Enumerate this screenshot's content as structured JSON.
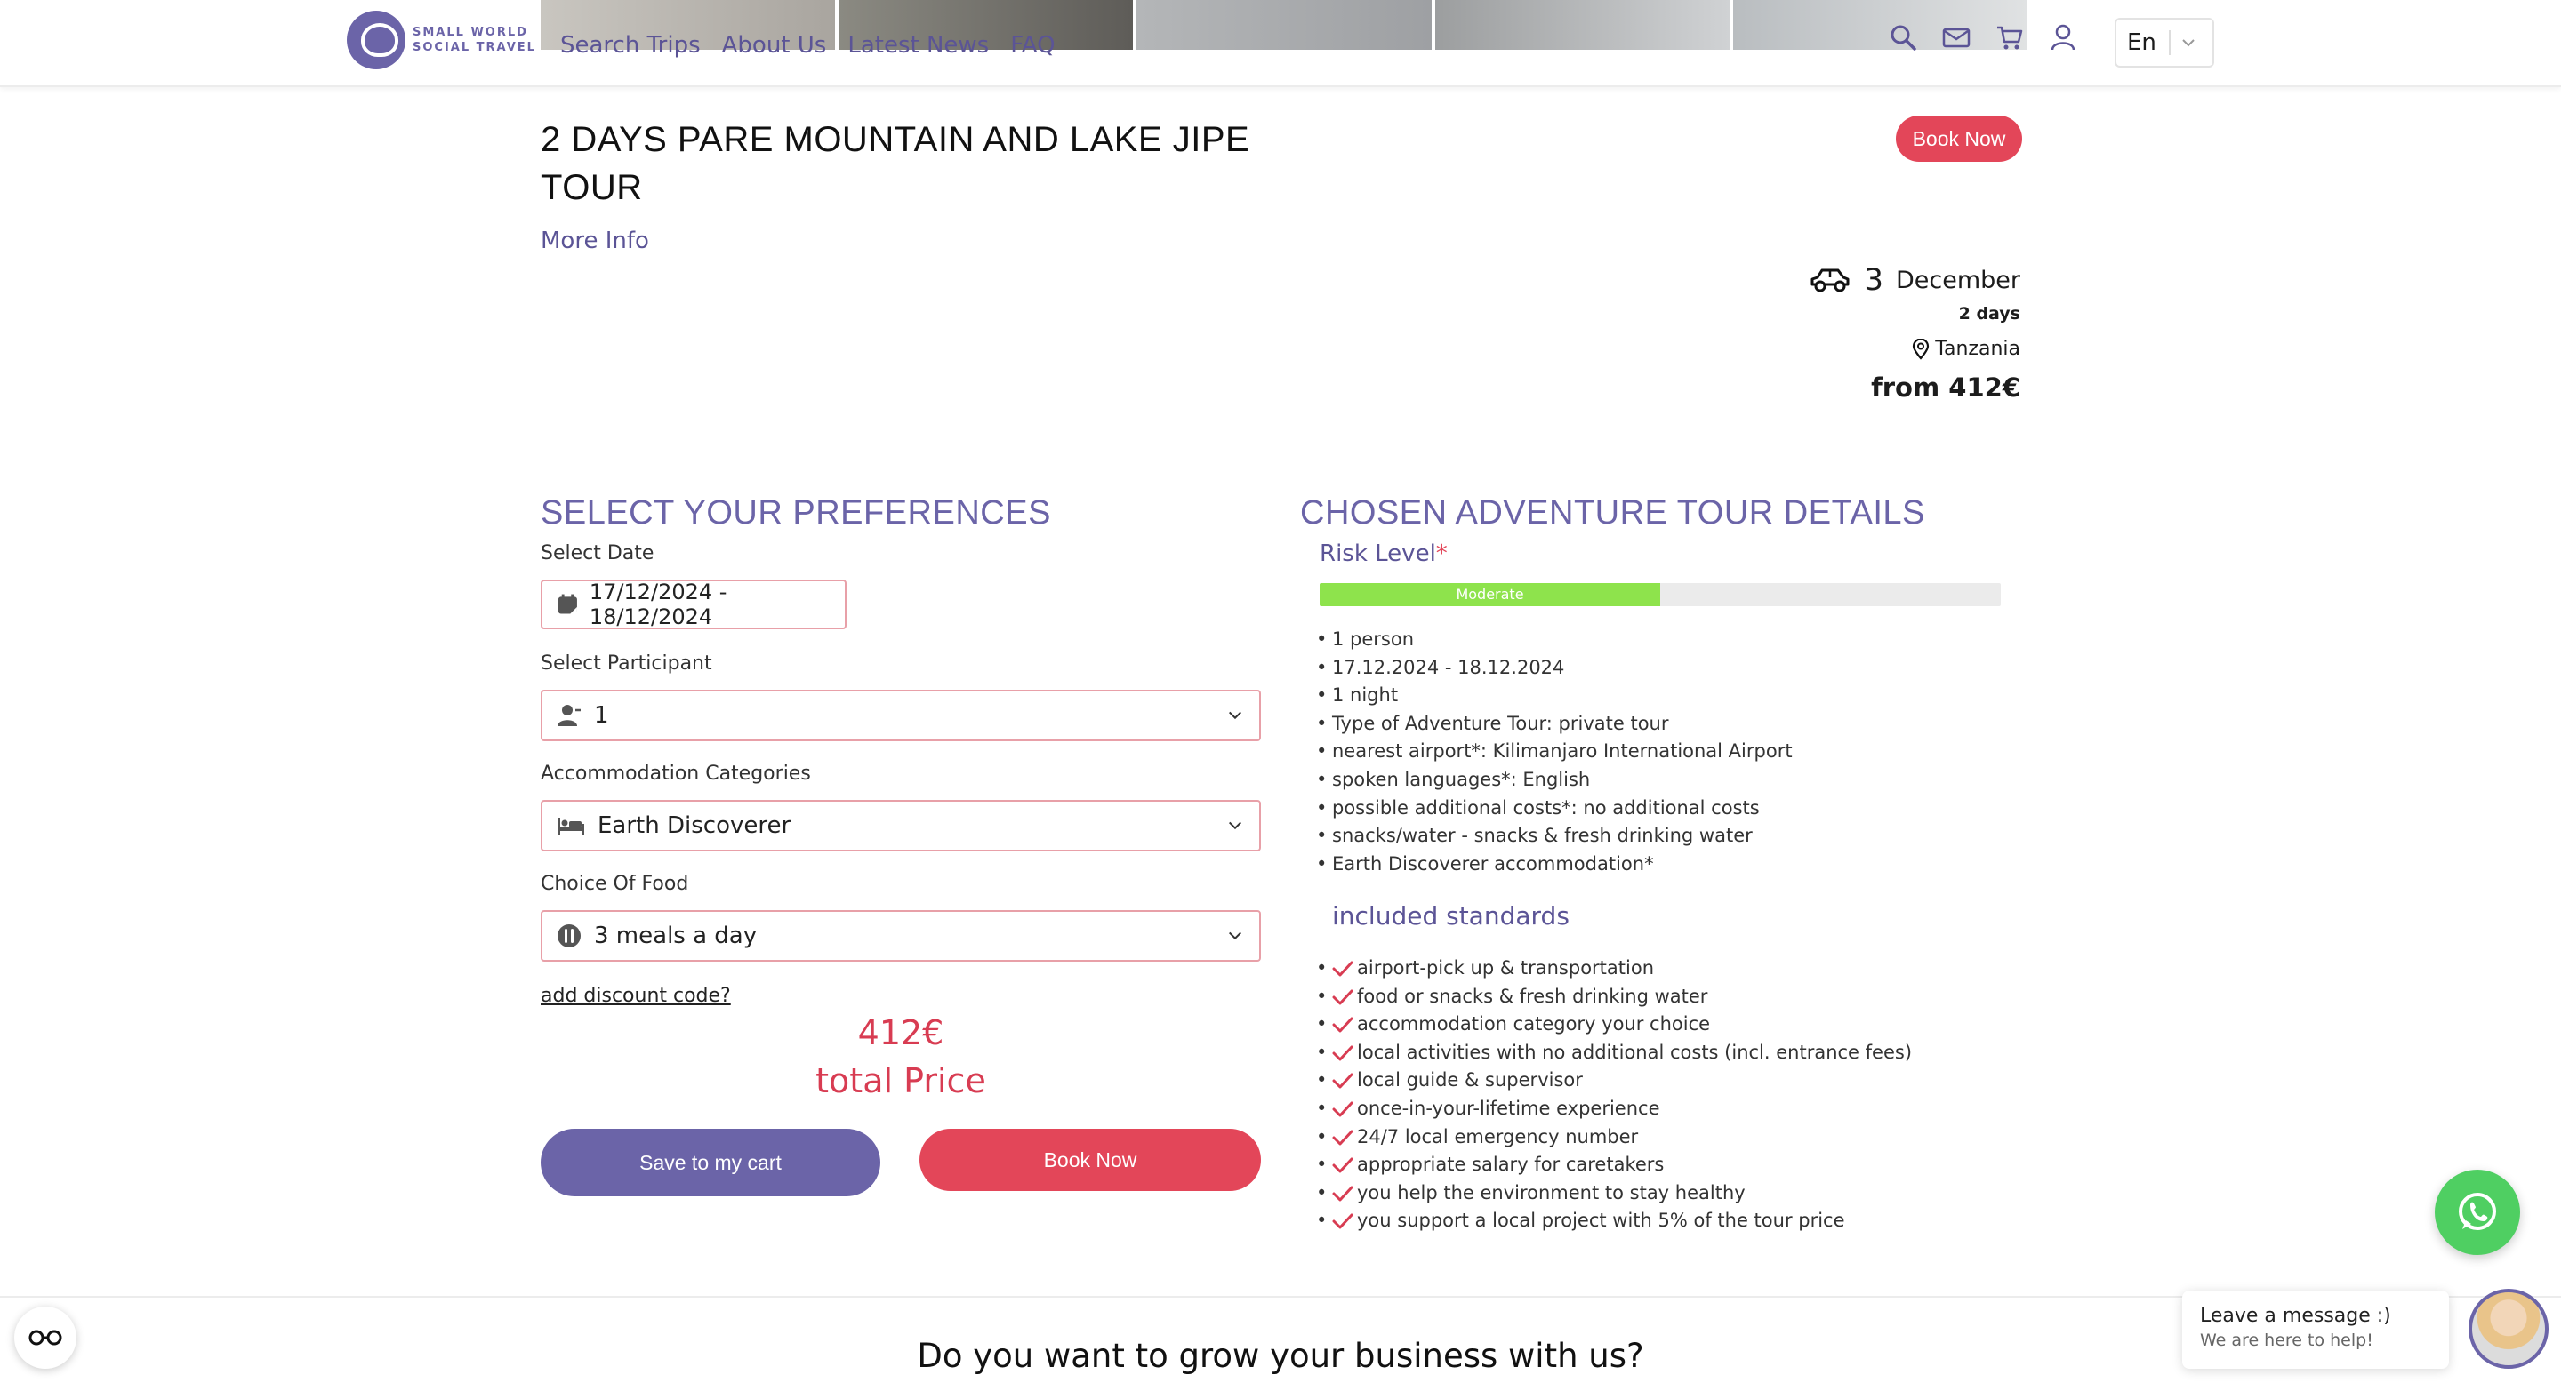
{
  "header": {
    "logo_line1": "SMALL WORLD",
    "logo_line2": "SOCIAL TRAVEL",
    "nav": [
      {
        "label": "Search Trips"
      },
      {
        "label": "About Us"
      },
      {
        "label": "Latest News"
      },
      {
        "label": "FAQ"
      }
    ],
    "icons": [
      "search-icon",
      "mail-icon",
      "cart-icon",
      "user-icon"
    ],
    "language": "En"
  },
  "trip": {
    "title": "2 DAYS PARE MOUNTAIN AND LAKE JIPE TOUR",
    "more_info": "More Info",
    "book_now": "Book Now",
    "vehicle_icon": "car-icon",
    "day_number": "3",
    "month": "December",
    "duration": "2 days",
    "country": "Tanzania",
    "price_from": "from 412€"
  },
  "preferences": {
    "title": "SELECT YOUR PREFERENCES",
    "date_label": "Select Date",
    "date_value": "17/12/2024 - 18/12/2024",
    "participant_label": "Select Participant",
    "participant_value": "1",
    "accommodation_label": "Accommodation Categories",
    "accommodation_value": "Earth Discoverer",
    "food_label": "Choice Of Food",
    "food_value": "3 meals a day",
    "discount_link": "add discount code?",
    "total_amount": "412€",
    "total_label": "total Price",
    "save_button": "Save to my cart",
    "book_button": "Book Now"
  },
  "details": {
    "title": "CHOSEN ADVENTURE TOUR DETAILS",
    "risk_label": "Risk Level",
    "risk_required": "*",
    "risk_value": "Moderate",
    "risk_fraction": 0.5,
    "items": [
      "1 person",
      "17.12.2024 - 18.12.2024",
      "1 night",
      "Type of Adventure Tour: private tour",
      "nearest airport*: Kilimanjaro International Airport",
      "spoken languages*: English",
      "possible additional costs*: no additional costs",
      "snacks/water - snacks & fresh drinking water",
      "Earth Discoverer accommodation*"
    ],
    "standards_title": "included standards",
    "standards": [
      "airport-pick up & transportation",
      "food or snacks & fresh drinking water",
      "accommodation category your choice",
      "local activities with no additional costs (incl. entrance fees)",
      "local guide & supervisor",
      "once-in-your-lifetime experience",
      "24/7 local emergency number",
      "appropriate salary for caretakers",
      "you help the environment to stay healthy",
      "you support a local project with 5% of the tour price"
    ]
  },
  "footer": {
    "grow_title": "Do you want to grow your business with us?",
    "chat_title": "Leave a message :)",
    "chat_subtitle": "We are here to help!"
  },
  "colors": {
    "brand_purple": "#6b64a8",
    "accent_red": "#e34659",
    "risk_green": "#8ee34c",
    "whatsapp_green": "#4fcf62"
  }
}
